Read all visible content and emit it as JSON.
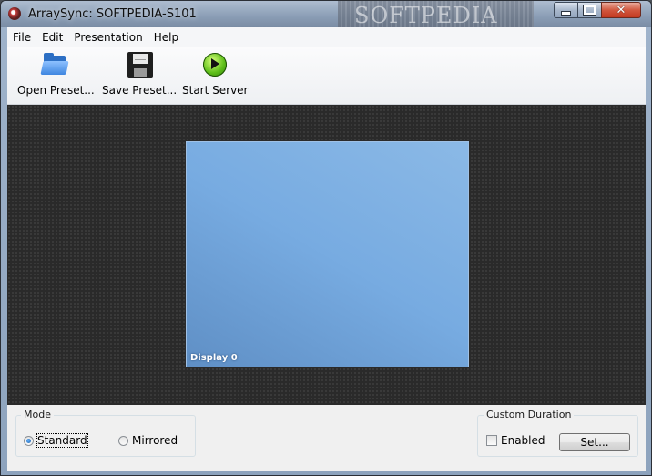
{
  "window": {
    "title": "ArraySync: SOFTPEDIA-S101",
    "banner_text": "SOFTPEDIA"
  },
  "menu": {
    "items": [
      "File",
      "Edit",
      "Presentation",
      "Help"
    ]
  },
  "toolbar": {
    "open_label": "Open Preset...",
    "save_label": "Save Preset...",
    "start_label": "Start Server"
  },
  "workspace": {
    "display_label": "Display 0"
  },
  "mode": {
    "title": "Mode",
    "standard_label": "Standard",
    "mirrored_label": "Mirrored",
    "selected": "Standard"
  },
  "custom_duration": {
    "title": "Custom Duration",
    "enabled_label": "Enabled",
    "enabled_checked": false,
    "set_label": "Set..."
  }
}
